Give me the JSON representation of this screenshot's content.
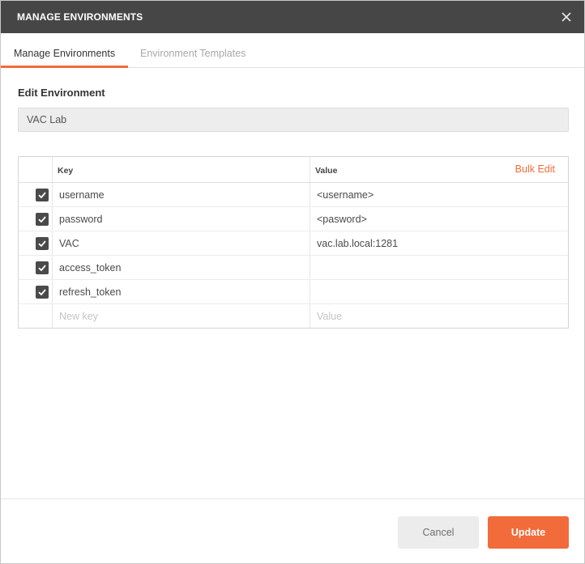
{
  "window": {
    "title": "MANAGE ENVIRONMENTS"
  },
  "tabs": [
    {
      "label": "Manage Environments",
      "active": true
    },
    {
      "label": "Environment Templates",
      "active": false
    }
  ],
  "editor": {
    "section_label": "Edit Environment",
    "environment_name": "VAC Lab"
  },
  "table": {
    "columns": {
      "key": "Key",
      "value": "Value"
    },
    "bulk_edit_label": "Bulk Edit",
    "rows": [
      {
        "checked": true,
        "key": "username",
        "value": "<username>"
      },
      {
        "checked": true,
        "key": "password",
        "value": "<pasword>"
      },
      {
        "checked": true,
        "key": "VAC",
        "value": "vac.lab.local:1281"
      },
      {
        "checked": true,
        "key": "access_token",
        "value": ""
      },
      {
        "checked": true,
        "key": "refresh_token",
        "value": ""
      }
    ],
    "new_row": {
      "key_placeholder": "New key",
      "value_placeholder": "Value"
    }
  },
  "footer": {
    "cancel_label": "Cancel",
    "update_label": "Update"
  },
  "colors": {
    "accent": "#f26b3a",
    "titlebar": "#464646"
  },
  "icons": {
    "close": "close-icon",
    "checkbox": "checkmark-icon"
  }
}
